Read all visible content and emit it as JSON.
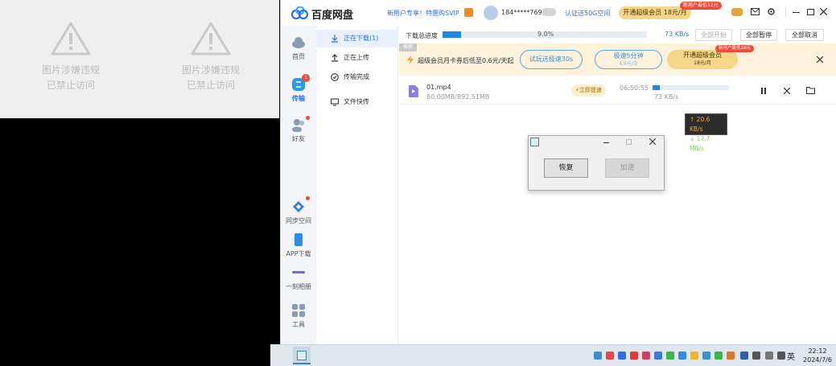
{
  "left_panel": {
    "blocked_images": [
      {
        "line1": "图片涉嫌违规",
        "line2": "已禁止访问"
      },
      {
        "line1": "图片涉嫌违规",
        "line2": "已禁止访问"
      }
    ]
  },
  "titlebar": {
    "app_name": "百度网盘",
    "promo_text": "新用户专享！特惠购SVIP",
    "username": "184*****769",
    "space_link": "认证送50G空间",
    "vip_button": "开通超级会员 18元/月",
    "vip_badge": "新用户最低12元"
  },
  "nav": {
    "items": [
      {
        "label": "首页"
      },
      {
        "label": "传输",
        "badge": "1"
      },
      {
        "label": "好友"
      },
      {
        "label": "同步空间"
      },
      {
        "label": "APP下载"
      },
      {
        "label": "一刻相册"
      },
      {
        "label": "工具"
      }
    ]
  },
  "sidebar": {
    "items": [
      {
        "label": "正在下载(1)"
      },
      {
        "label": "正在上传"
      },
      {
        "label": "传输完成"
      },
      {
        "label": "文件快传"
      }
    ]
  },
  "download_header": {
    "label": "下载总进度",
    "percent_text": "9.0%",
    "progress": 0.09,
    "speed": "73 KB/s",
    "btn_start_all": "全部开始",
    "btn_pause_all": "全部暂停",
    "btn_cancel_all": "全部取消"
  },
  "promo_banner": {
    "tag": "推荐",
    "text": "超级会员月卡券后低至0.6元/天起",
    "btn_trial": "试玩送极速30s",
    "btn_speed_title": "极速5分钟",
    "btn_speed_sub": "4.9元/次",
    "btn_vip_title": "开通超级会员",
    "btn_vip_sub": "18元/月",
    "btn_vip_badge": "新用户最低18元"
  },
  "file_row": {
    "name": "01.mp4",
    "size": "80.00MB/892.51MB",
    "boost_label": "立即提速",
    "time_left": "06:50:55",
    "speed": "73 KB/s",
    "progress": 0.09
  },
  "speed_tooltip": {
    "up": "↑ 20.6 KB/s",
    "down": "↓ 17.7 MB/s"
  },
  "dialog": {
    "btn_restore": "恢复",
    "btn_speedup": "加速"
  },
  "taskbar": {
    "ime": "英",
    "time": "22:12",
    "date": "2024/7/6"
  },
  "colors": {
    "accent": "#2b6fe8",
    "promo_bg": "#fdf3dd",
    "vip_gold": "#f6d78a",
    "badge_red": "#f04a3a"
  }
}
